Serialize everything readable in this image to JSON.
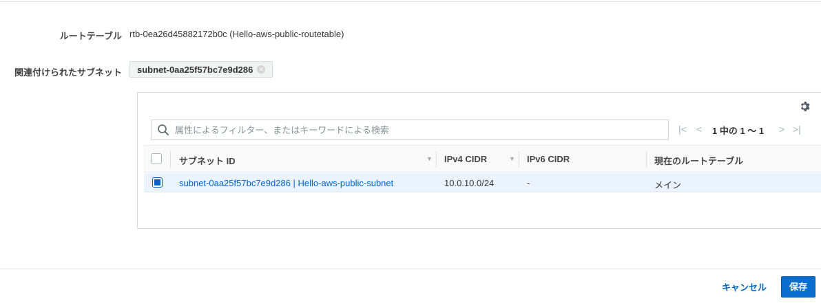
{
  "form": {
    "route_table_label": "ルートテーブル",
    "route_table_value": "rtb-0ea26d45882172b0c (Hello-aws-public-routetable)",
    "subnets_label": "関連付けられたサブネット",
    "selected_chip": "subnet-0aa25f57bc7e9d286"
  },
  "table_panel": {
    "search_placeholder": "属性によるフィルター、またはキーワードによる検索",
    "pagination_text": "1 中の 1 〜 1",
    "columns": [
      "サブネット ID",
      "IPv4 CIDR",
      "IPv6 CIDR",
      "現在のルートテーブル"
    ],
    "rows": [
      {
        "subnet_id": "subnet-0aa25f57bc7e9d286 | Hello-aws-public-subnet",
        "ipv4_cidr": "10.0.10.0/24",
        "ipv6_cidr": "-",
        "route_table": "メイン",
        "selected": true
      }
    ]
  },
  "footer": {
    "cancel_label": "キャンセル",
    "save_label": "保存"
  },
  "colors": {
    "link": "#0066c0",
    "primary_button": "#0a6ecf",
    "selected_row": "#eaf3fe"
  }
}
